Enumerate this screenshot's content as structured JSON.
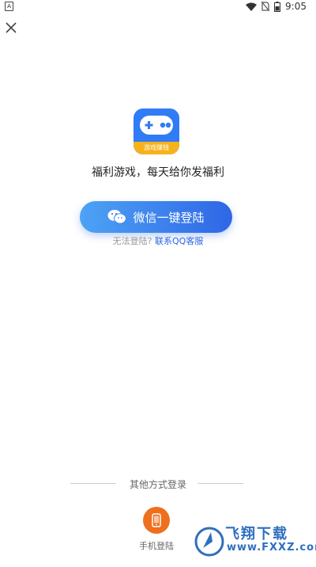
{
  "status_bar": {
    "left_icon": "A",
    "time": "9:05",
    "icons": [
      "wifi-icon",
      "no-sim-icon",
      "battery-icon"
    ]
  },
  "header": {
    "close_icon": "close-icon"
  },
  "app": {
    "logo_text": "游戏赚钱",
    "tagline": "福利游戏，每天给你发福利"
  },
  "wechat_login": {
    "label": "微信一键登陆",
    "icon": "wechat-icon"
  },
  "help": {
    "prefix": "无法登陆?",
    "link": "联系QQ客服"
  },
  "other_methods": {
    "title": "其他方式登录",
    "phone_label": "手机登陆",
    "phone_icon": "phone-icon"
  },
  "watermark": {
    "text": "飞翔下载",
    "url": "www.FXXZ.com"
  },
  "colors": {
    "primary": "#2f66e6",
    "accent_orange": "#ee6f1e",
    "logo_yellow": "#f6b21b"
  }
}
